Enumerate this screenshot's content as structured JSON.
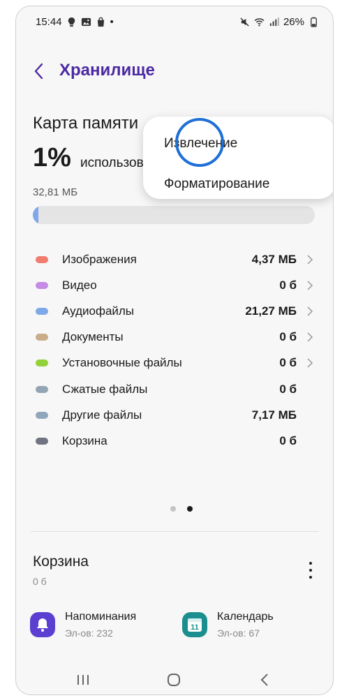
{
  "status_bar": {
    "time": "15:44",
    "dot": "•",
    "battery": "26%",
    "left_icons": [
      "bulb-icon",
      "gallery-icon",
      "bag-icon"
    ],
    "right_icons": [
      "mute-icon",
      "wifi-icon",
      "signal-icon",
      "battery-icon"
    ]
  },
  "header": {
    "title": "Хранилище",
    "accent_color": "#4b2aa3"
  },
  "memory_card": {
    "title": "Карта памяти",
    "used_percent": "1%",
    "used_label": "использовано",
    "used_size": "32,81 МБ",
    "used_fraction": 0.01
  },
  "categories": [
    {
      "label": "Изображения",
      "value": "4,37 МБ",
      "color": "#f07d6e",
      "chevron": true
    },
    {
      "label": "Видео",
      "value": "0 б",
      "color": "#c58be6",
      "chevron": true
    },
    {
      "label": "Аудиофайлы",
      "value": "21,27 МБ",
      "color": "#7fa8e8",
      "chevron": true
    },
    {
      "label": "Документы",
      "value": "0 б",
      "color": "#c8ad88",
      "chevron": true
    },
    {
      "label": "Установочные файлы",
      "value": "0 б",
      "color": "#93d13a",
      "chevron": true
    },
    {
      "label": "Сжатые файлы",
      "value": "0 б",
      "color": "#93a4b4",
      "chevron": false
    },
    {
      "label": "Другие файлы",
      "value": "7,17 МБ",
      "color": "#8fa6bb",
      "chevron": false
    },
    {
      "label": "Корзина",
      "value": "0 б",
      "color": "#6f7480",
      "chevron": false
    }
  ],
  "page_indicator": {
    "count": 2,
    "active": 2
  },
  "trash": {
    "title": "Корзина",
    "size": "0 б",
    "apps": [
      {
        "name": "Напоминания",
        "count": "Эл-ов: 232",
        "icon": "reminder-bell-icon",
        "color": "#5b3fd1"
      },
      {
        "name": "Календарь",
        "count": "Эл-ов: 67",
        "icon": "calendar-icon",
        "color": "#1b8f8f",
        "day": "11"
      }
    ]
  },
  "popup_menu": {
    "items": [
      "Извлечение",
      "Форматирование"
    ]
  },
  "nav_bar": {
    "buttons": [
      "recent-apps-icon",
      "home-icon",
      "back-icon"
    ]
  }
}
